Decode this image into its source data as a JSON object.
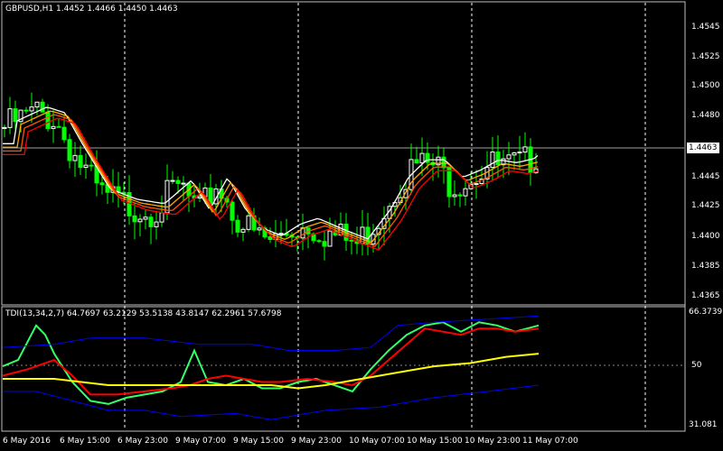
{
  "main": {
    "header": "GBPUSD,H1  1.4452 1.4466 1.4450 1.4463",
    "price_ticks": [
      "1.4545",
      "1.4525",
      "1.4500",
      "1.4480",
      "1.4463",
      "1.4445",
      "1.4425",
      "1.4400",
      "1.4385",
      "1.4365"
    ],
    "current_price": "1.4463",
    "ylim": [
      1.4358,
      1.4563
    ]
  },
  "indicator": {
    "header": "TDI(13,34,2,7) 64.7697 63.2129 53.5138 43.8147 62.2961 57.6798",
    "ticks": [
      "66.3739",
      "50",
      "31.081"
    ],
    "ylim": [
      31.081,
      66.3739
    ]
  },
  "time_axis": [
    "6 May 2016",
    "6 May 15:00",
    "6 May 23:00",
    "9 May 07:00",
    "9 May 15:00",
    "9 May 23:00",
    "10 May 07:00",
    "10 May 15:00",
    "10 May 23:00",
    "11 May 07:00"
  ],
  "colors": {
    "background": "#000000",
    "bull_candle": "#ffffff",
    "bear_candle": "#00ff00",
    "rsi_line": "#33ff66",
    "signal_line": "#ff0000",
    "market_base_line": "#ffff00",
    "volatility_band": "#0000ff",
    "ma_ribbon": [
      "#ffffff",
      "#ffaa00",
      "#ff5500",
      "#ff0000"
    ]
  }
}
